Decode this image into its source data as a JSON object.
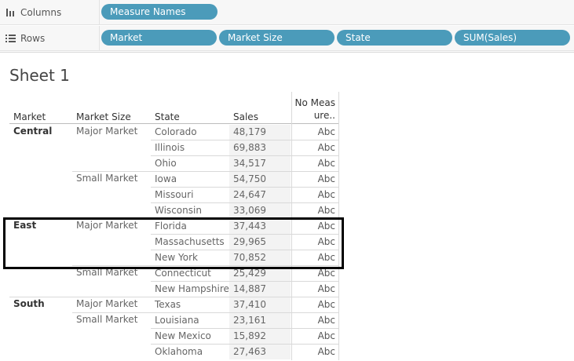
{
  "shelves": {
    "columns": {
      "label": "Columns",
      "icon": "columns-icon",
      "pills": [
        "Measure Names"
      ]
    },
    "rows": {
      "label": "Rows",
      "icon": "rows-icon",
      "pills": [
        "Market",
        "Market Size",
        "State",
        "SUM(Sales)"
      ]
    }
  },
  "sheet": {
    "title": "Sheet 1",
    "headers": {
      "market": "Market",
      "market_size": "Market Size",
      "state": "State",
      "sales": "Sales",
      "measure_line1": "No Meas",
      "measure_line2": "ure.."
    },
    "markets": [
      "Central",
      "East",
      "South"
    ],
    "sizes": [
      "Major Market",
      "Small Market",
      "Major Market",
      "Small Market",
      "Major Market",
      "Small Market"
    ],
    "rows": [
      {
        "state": "Colorado",
        "sales": "48,179",
        "measure": "Abc"
      },
      {
        "state": "Illinois",
        "sales": "69,883",
        "measure": "Abc"
      },
      {
        "state": "Ohio",
        "sales": "34,517",
        "measure": "Abc"
      },
      {
        "state": "Iowa",
        "sales": "54,750",
        "measure": "Abc"
      },
      {
        "state": "Missouri",
        "sales": "24,647",
        "measure": "Abc"
      },
      {
        "state": "Wisconsin",
        "sales": "33,069",
        "measure": "Abc"
      },
      {
        "state": "Florida",
        "sales": "37,443",
        "measure": "Abc"
      },
      {
        "state": "Massachusetts",
        "sales": "29,965",
        "measure": "Abc"
      },
      {
        "state": "New York",
        "sales": "70,852",
        "measure": "Abc"
      },
      {
        "state": "Connecticut",
        "sales": "25,429",
        "measure": "Abc"
      },
      {
        "state": "New Hampshire",
        "sales": "14,887",
        "measure": "Abc"
      },
      {
        "state": "Texas",
        "sales": "37,410",
        "measure": "Abc"
      },
      {
        "state": "Louisiana",
        "sales": "23,161",
        "measure": "Abc"
      },
      {
        "state": "New Mexico",
        "sales": "15,892",
        "measure": "Abc"
      },
      {
        "state": "Oklahoma",
        "sales": "27,463",
        "measure": "Abc"
      }
    ]
  }
}
